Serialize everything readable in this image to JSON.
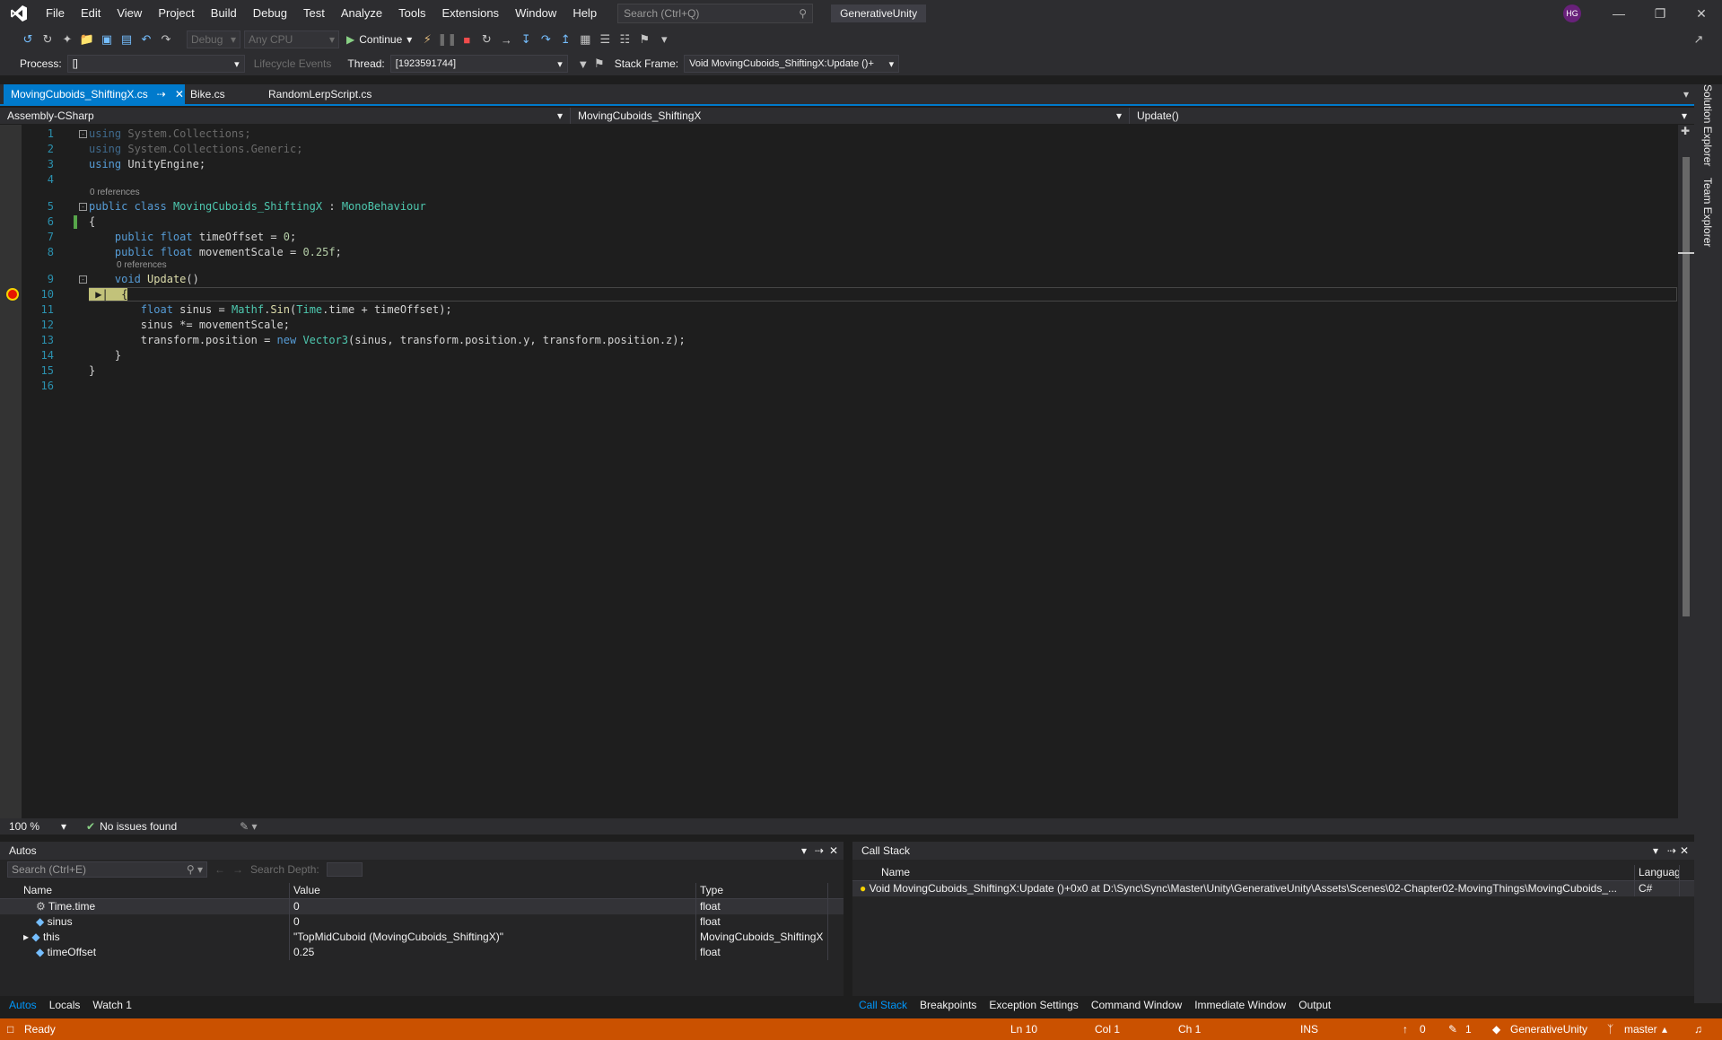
{
  "menu": {
    "items": [
      "File",
      "Edit",
      "View",
      "Project",
      "Build",
      "Debug",
      "Test",
      "Analyze",
      "Tools",
      "Extensions",
      "Window",
      "Help"
    ],
    "search_placeholder": "Search (Ctrl+Q)",
    "solution_name": "GenerativeUnity",
    "avatar_initials": "HG"
  },
  "toolbar": {
    "config": "Debug",
    "platform": "Any CPU",
    "continue_label": "Continue"
  },
  "debug_location": {
    "process_label": "Process:",
    "process_value": "[]",
    "lifecycle_label": "Lifecycle Events",
    "thread_label": "Thread:",
    "thread_value": "[1923591744]",
    "stack_frame_label": "Stack Frame:",
    "stack_frame_value": "Void MovingCuboids_ShiftingX:Update ()+"
  },
  "tabs": [
    {
      "label": "MovingCuboids_ShiftingX.cs",
      "active": true
    },
    {
      "label": "Bike.cs",
      "active": false
    },
    {
      "label": "RandomLerpScript.cs",
      "active": false
    }
  ],
  "navbar": {
    "project": "Assembly-CSharp",
    "class": "MovingCuboids_ShiftingX",
    "member": "Update()"
  },
  "code": {
    "codelens_class": "0 references",
    "codelens_method": "0 references",
    "line_numbers": [
      "1",
      "2",
      "3",
      "4",
      "5",
      "6",
      "7",
      "8",
      "9",
      "10",
      "11",
      "12",
      "13",
      "14",
      "15",
      "16"
    ]
  },
  "editor_status": {
    "zoom": "100 %",
    "issues": "No issues found"
  },
  "autos": {
    "title": "Autos",
    "search_placeholder": "Search (Ctrl+E)",
    "search_depth_label": "Search Depth:",
    "columns": [
      "Name",
      "Value",
      "Type"
    ],
    "rows": [
      {
        "name": "Time.time",
        "value": "0",
        "type": "float"
      },
      {
        "name": "sinus",
        "value": "0",
        "type": "float"
      },
      {
        "name": "this",
        "value": "\"TopMidCuboid (MovingCuboids_ShiftingX)\"",
        "type": "MovingCuboids_ShiftingX"
      },
      {
        "name": "timeOffset",
        "value": "0.25",
        "type": "float"
      }
    ],
    "tabs": [
      "Autos",
      "Locals",
      "Watch 1"
    ]
  },
  "callstack": {
    "title": "Call Stack",
    "columns": [
      "Name",
      "Languag"
    ],
    "rows": [
      {
        "name": "Void MovingCuboids_ShiftingX:Update ()+0x0 at D:\\Sync\\Sync\\Master\\Unity\\GenerativeUnity\\Assets\\Scenes\\02-Chapter02-MovingThings\\MovingCuboids_...",
        "lang": "C#"
      }
    ],
    "tabs": [
      "Call Stack",
      "Breakpoints",
      "Exception Settings",
      "Command Window",
      "Immediate Window",
      "Output"
    ]
  },
  "status": {
    "ready": "Ready",
    "ln": "Ln 10",
    "col": "Col 1",
    "ch": "Ch 1",
    "ins": "INS",
    "up_count": "0",
    "pending_count": "1",
    "repo": "GenerativeUnity",
    "branch": "master"
  },
  "side_tabs": [
    "Solution Explorer",
    "Team Explorer"
  ],
  "colors": {
    "accent": "#007acc",
    "status_debug": "#ca5100",
    "keyword": "#569cd6",
    "type": "#4ec9b0"
  }
}
